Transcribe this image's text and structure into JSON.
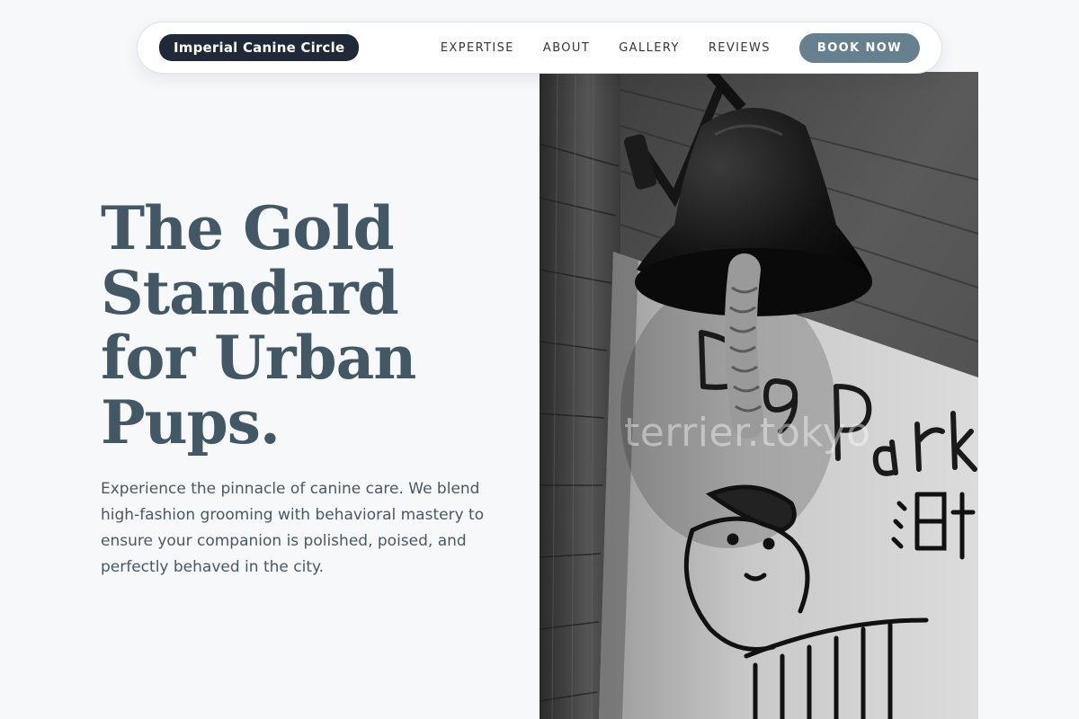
{
  "nav": {
    "brand": "Imperial Canine Circle",
    "links": [
      "EXPERTISE",
      "ABOUT",
      "GALLERY",
      "REVIEWS"
    ],
    "cta": "BOOK NOW"
  },
  "hero": {
    "title_lines": [
      "The Gold",
      "Standard",
      "for Urban",
      "Pups."
    ],
    "description": "Experience the pinnacle of canine care. We blend high-fashion grooming with behavioral mastery to ensure your companion is polished, poised, and perfectly behaved in the city."
  },
  "photo": {
    "watermark": "terrier.tokyo",
    "sign_text": "Dog Park"
  },
  "colors": {
    "background": "#f6f8fa",
    "brand_pill": "#1f2937",
    "cta": "#66808f",
    "headline": "#435864",
    "body_text": "#4a5866"
  }
}
